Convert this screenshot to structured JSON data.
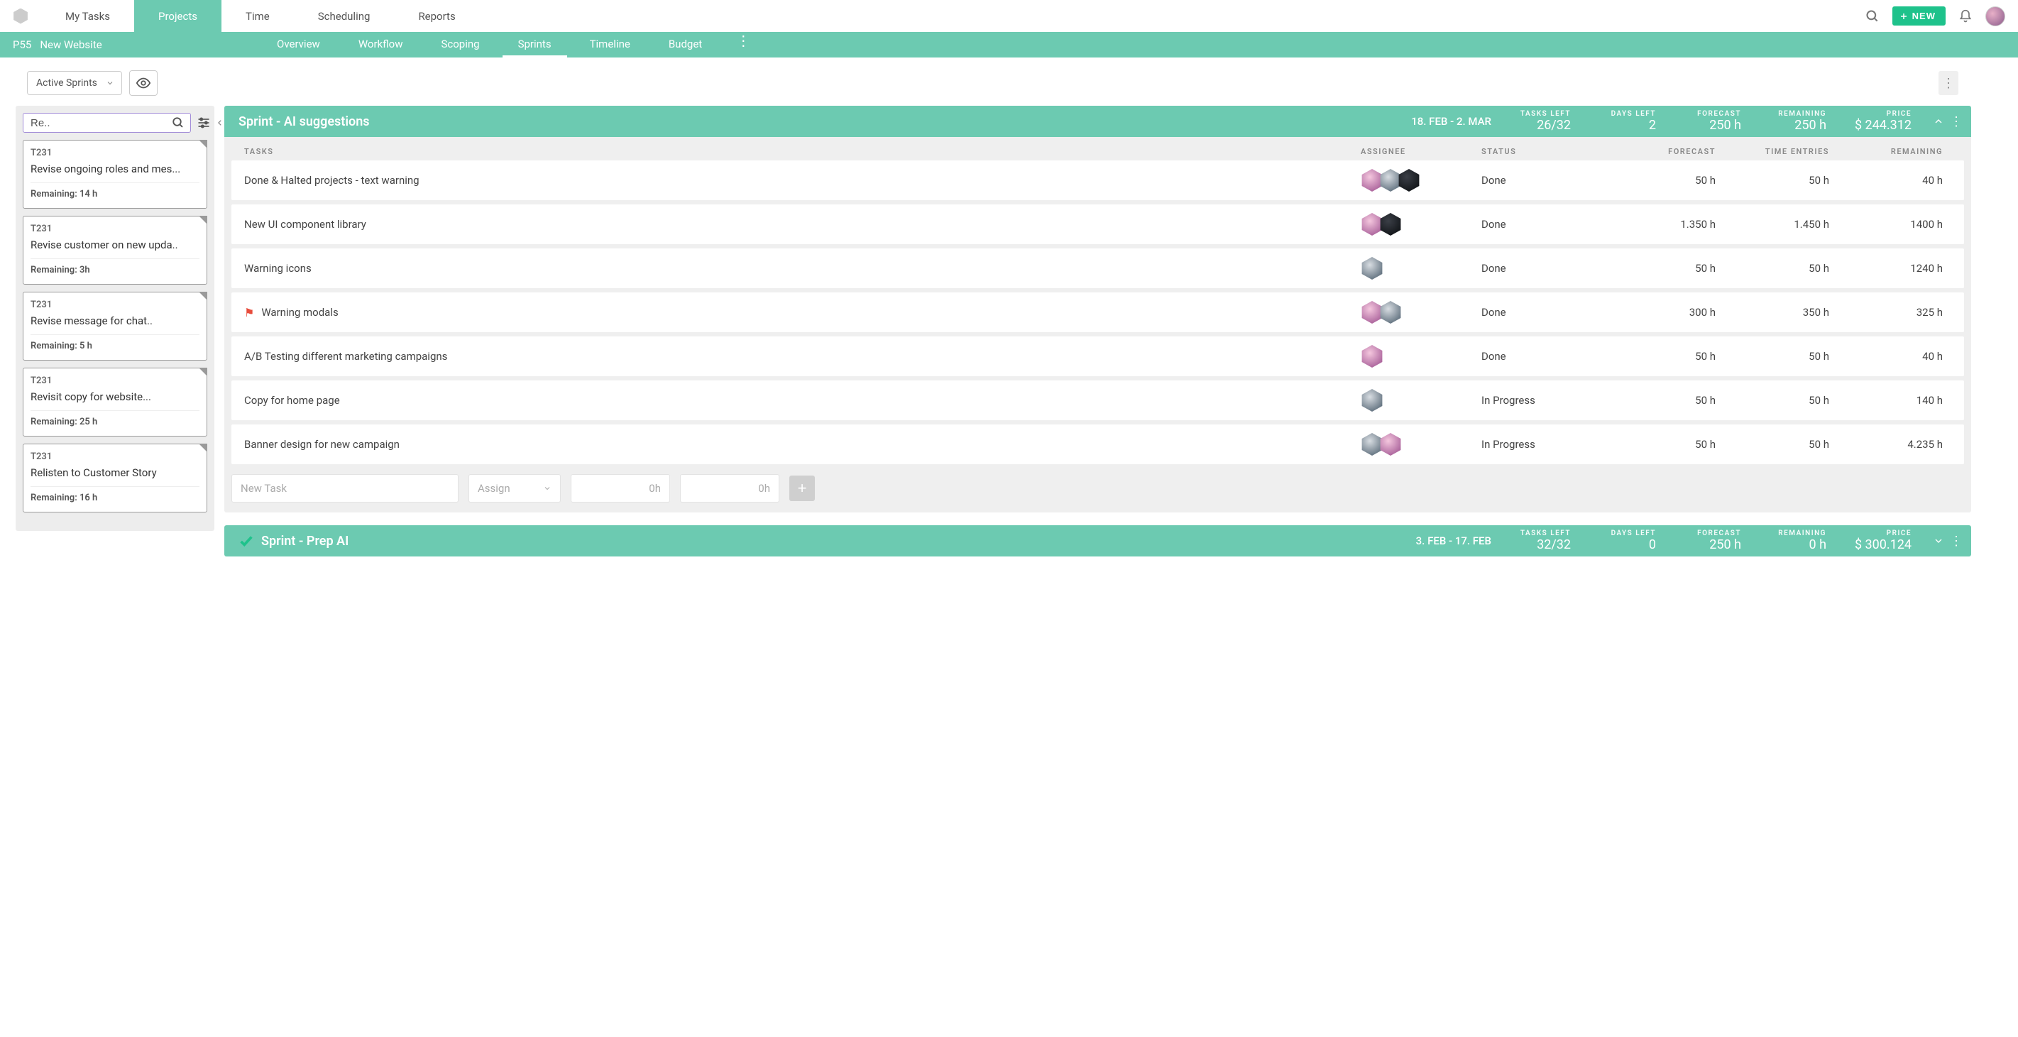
{
  "topnav": {
    "tabs": [
      "My Tasks",
      "Projects",
      "Time",
      "Scheduling",
      "Reports"
    ],
    "active_index": 1,
    "new_label": "NEW"
  },
  "subnav": {
    "project_code": "P55",
    "project_name": "New Website",
    "tabs": [
      "Overview",
      "Workflow",
      "Scoping",
      "Sprints",
      "Timeline",
      "Budget"
    ],
    "active_index": 3
  },
  "filter_select": "Active Sprints",
  "search_value": "Re..",
  "backlog": [
    {
      "id": "T231",
      "title": "Revise ongoing roles and mes...",
      "remaining": "Remaining: 14 h"
    },
    {
      "id": "T231",
      "title": "Revise customer on new upda..",
      "remaining": "Remaining: 3h"
    },
    {
      "id": "T231",
      "title": "Revise message for chat..",
      "remaining": "Remaining: 5 h"
    },
    {
      "id": "T231",
      "title": "Revisit copy for website...",
      "remaining": "Remaining: 25 h"
    },
    {
      "id": "T231",
      "title": "Relisten to Customer Story",
      "remaining": "Remaining: 16 h"
    }
  ],
  "table_headers": {
    "tasks": "TASKS",
    "assignee": "ASSIGNEE",
    "status": "STATUS",
    "forecast": "FORECAST",
    "time_entries": "TIME ENTRIES",
    "remaining": "REMAINING"
  },
  "metric_labels": {
    "tasks_left": "TASKS LEFT",
    "days_left": "DAYS LEFT",
    "forecast": "FORECAST",
    "remaining": "REMAINING",
    "price": "PRICE"
  },
  "sprints": [
    {
      "title": "Sprint - AI suggestions",
      "range": "18. FEB - 2. MAR",
      "metrics": {
        "tasks_left": "26/32",
        "days_left": "2",
        "forecast": "250 h",
        "remaining": "250 h",
        "price": "$ 244.312"
      },
      "expanded": true,
      "completed": false,
      "tasks": [
        {
          "name": "Done & Halted projects - text warning",
          "flag": false,
          "assignees": [
            "pink",
            "grey",
            "dark"
          ],
          "status": "Done",
          "forecast": "50 h",
          "time": "50 h",
          "remaining": "40 h"
        },
        {
          "name": "New UI component library",
          "flag": false,
          "assignees": [
            "pink",
            "dark"
          ],
          "status": "Done",
          "forecast": "1.350 h",
          "time": "1.450 h",
          "remaining": "1400 h"
        },
        {
          "name": "Warning icons",
          "flag": false,
          "assignees": [
            "grey"
          ],
          "status": "Done",
          "forecast": "50 h",
          "time": "50 h",
          "remaining": "1240 h"
        },
        {
          "name": "Warning modals",
          "flag": true,
          "assignees": [
            "pink",
            "grey"
          ],
          "status": "Done",
          "forecast": "300 h",
          "time": "350 h",
          "remaining": "325 h"
        },
        {
          "name": "A/B Testing different marketing campaigns",
          "flag": false,
          "assignees": [
            "pink"
          ],
          "status": "Done",
          "forecast": "50 h",
          "time": "50 h",
          "remaining": "40 h"
        },
        {
          "name": "Copy for home page",
          "flag": false,
          "assignees": [
            "grey"
          ],
          "status": "In Progress",
          "forecast": "50 h",
          "time": "50 h",
          "remaining": "140 h"
        },
        {
          "name": "Banner design for new campaign",
          "flag": false,
          "assignees": [
            "grey",
            "pink"
          ],
          "status": "In Progress",
          "forecast": "50 h",
          "time": "50 h",
          "remaining": "4.235 h"
        }
      ]
    },
    {
      "title": "Sprint - Prep AI",
      "range": "3. FEB - 17. FEB",
      "metrics": {
        "tasks_left": "32/32",
        "days_left": "0",
        "forecast": "250 h",
        "remaining": "0 h",
        "price": "$ 300.124"
      },
      "expanded": false,
      "completed": true,
      "tasks": []
    }
  ],
  "new_task": {
    "placeholder": "New Task",
    "assign_placeholder": "Assign",
    "zero_h": "0h"
  }
}
